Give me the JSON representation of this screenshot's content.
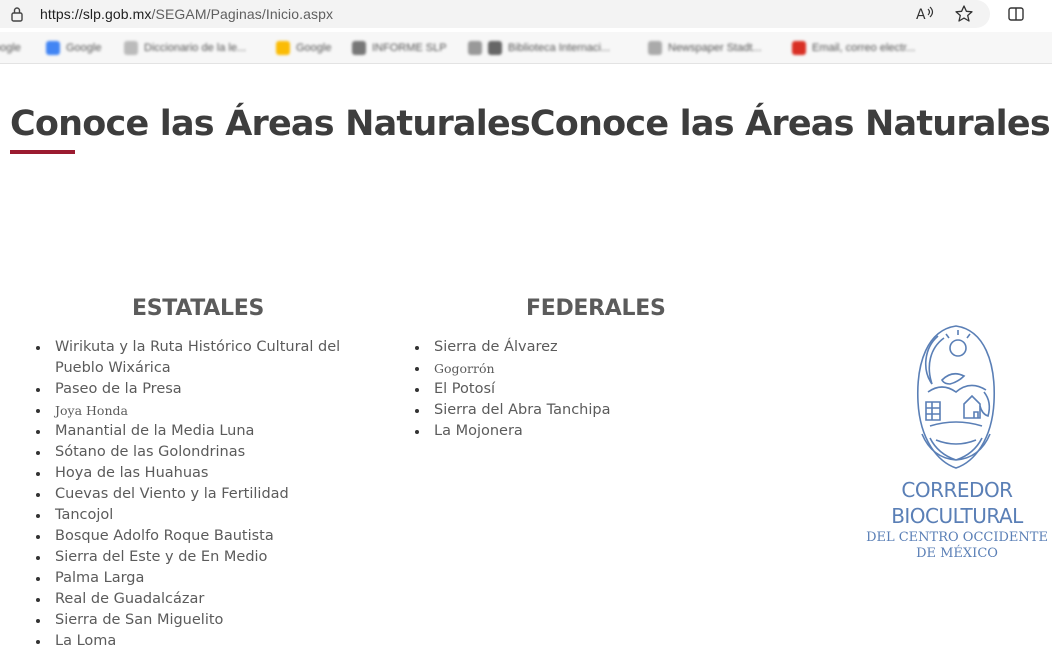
{
  "browser": {
    "url_host": "https://slp.gob.mx",
    "url_path": "/SEGAM/Paginas/Inicio.aspx",
    "bookmarks": [
      {
        "label": "Google",
        "color": "#4285f4"
      },
      {
        "label": "Google",
        "color": "#34a853"
      },
      {
        "label": "Diccionario de la le...",
        "color": "#999999"
      },
      {
        "label": "Google",
        "color": "#fbbc05"
      },
      {
        "label": "INFORME SLP",
        "color": "#777777"
      },
      {
        "label": "Biblioteca Internaci...",
        "color": "#666666"
      },
      {
        "label": "Newspaper Stadt...",
        "color": "#888888"
      },
      {
        "label": "Email, correo electr...",
        "color": "#d93025"
      }
    ]
  },
  "page": {
    "title": "Conoce las Áreas NaturalesConoce las Áreas Naturales",
    "accent": "#9b1b30"
  },
  "estatales": {
    "heading": "ESTATALES",
    "items": [
      "Wirikuta y la Ruta Histórico Cultural del Pueblo Wixárica",
      "Paseo de la Presa",
      "Joya Honda",
      "Manantial de la Media Luna",
      "Sótano de las Golondrinas",
      "Hoya de las Huahuas",
      "Cuevas del Viento y la Fertilidad",
      "Tancojol",
      "Bosque Adolfo Roque Bautista",
      "Sierra del Este y de En Medio",
      "Palma Larga",
      "Real de Guadalcázar",
      "Sierra de San Miguelito",
      "La Loma"
    ]
  },
  "federales": {
    "heading": "FEDERALES",
    "items": [
      "Sierra de Álvarez",
      "Gogorrón",
      "El Potosí",
      "Sierra del Abra Tanchipa",
      "La Mojonera"
    ]
  },
  "logo": {
    "line1": "CORREDOR",
    "line2": "BIOCULTURAL",
    "line3": "DEL CENTRO OCCIDENTE",
    "line4": "DE MÉXICO",
    "color": "#5a7fb6"
  }
}
